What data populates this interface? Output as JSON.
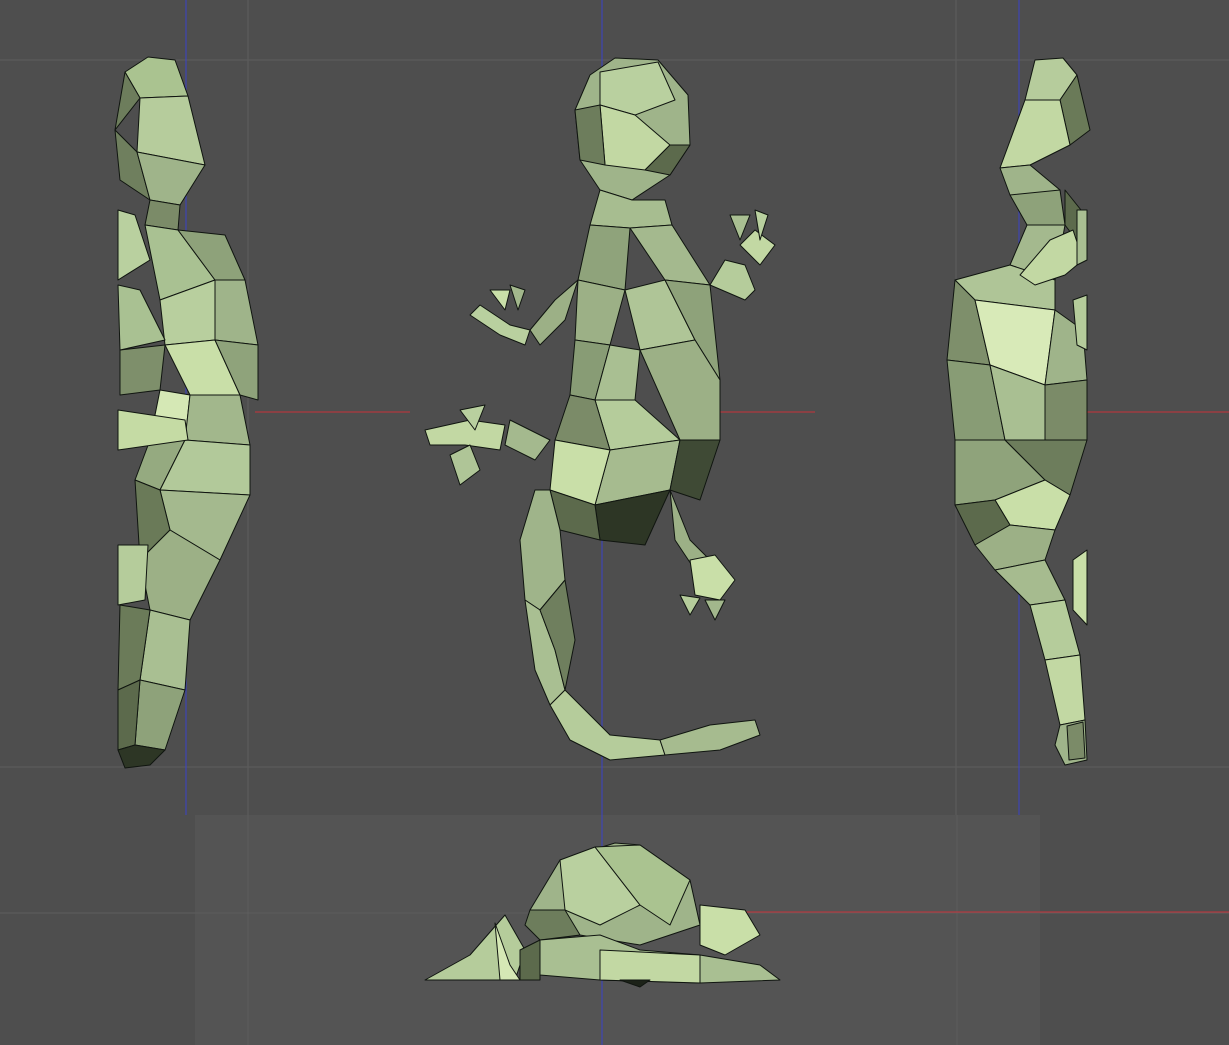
{
  "colors": {
    "background": "#4a4a4a",
    "viewport": "#4e4e4e",
    "grid": "#5d5d5d",
    "axis_x": "#c8323a",
    "axis_y": "#3a42c8",
    "mesh_light": "#c9dfa8",
    "mesh_mid": "#9fb48a",
    "mesh_dark": "#5c6a4c",
    "mesh_shadow": "#1c2218",
    "edge": "#101510"
  },
  "viewports": [
    {
      "name": "left-view",
      "model": "gecko-side"
    },
    {
      "name": "top-view",
      "model": "gecko-top"
    },
    {
      "name": "right-view",
      "model": "gecko-side"
    },
    {
      "name": "front-view",
      "model": "gecko-front"
    }
  ],
  "icons": {
    "model": "gecko-lowpoly-mesh"
  }
}
